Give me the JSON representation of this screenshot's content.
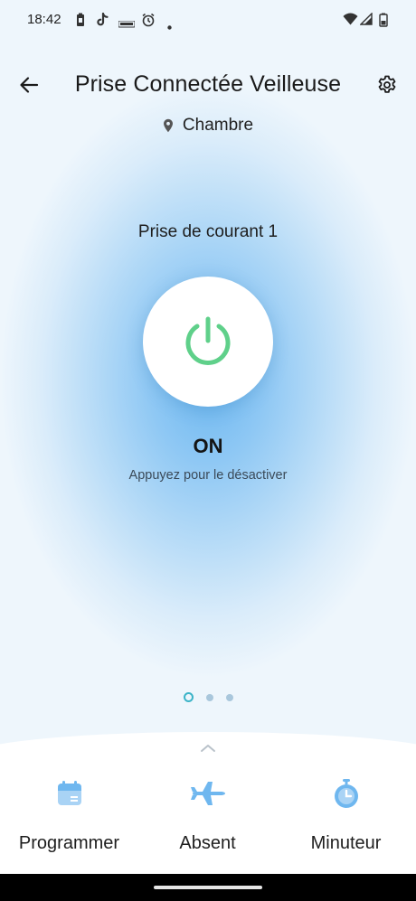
{
  "status_bar": {
    "time": "18:42",
    "icons": [
      "battery-saver-icon",
      "tiktok-icon",
      "cast-icon",
      "alarm-icon",
      "dot-icon",
      "wifi-icon",
      "signal-icon",
      "battery-icon"
    ]
  },
  "header": {
    "title": "Prise Connectée Veilleuse",
    "back_icon": "arrow-left-icon",
    "settings_icon": "gear-icon"
  },
  "location": {
    "icon": "location-pin-icon",
    "room": "Chambre"
  },
  "outlet": {
    "label": "Prise de courant 1",
    "power_icon": "power-icon",
    "state": "ON",
    "hint": "Appuyez pour le désactiver"
  },
  "pager": {
    "count": 3,
    "active_index": 0
  },
  "actions": [
    {
      "label": "Programmer",
      "icon": "calendar-icon"
    },
    {
      "label": "Absent",
      "icon": "airplane-icon"
    },
    {
      "label": "Minuteur",
      "icon": "timer-icon"
    }
  ],
  "colors": {
    "accent_green": "#5fd08a",
    "action_blue": "#6fb7ef",
    "glow_blue": "#6cb7f0"
  }
}
